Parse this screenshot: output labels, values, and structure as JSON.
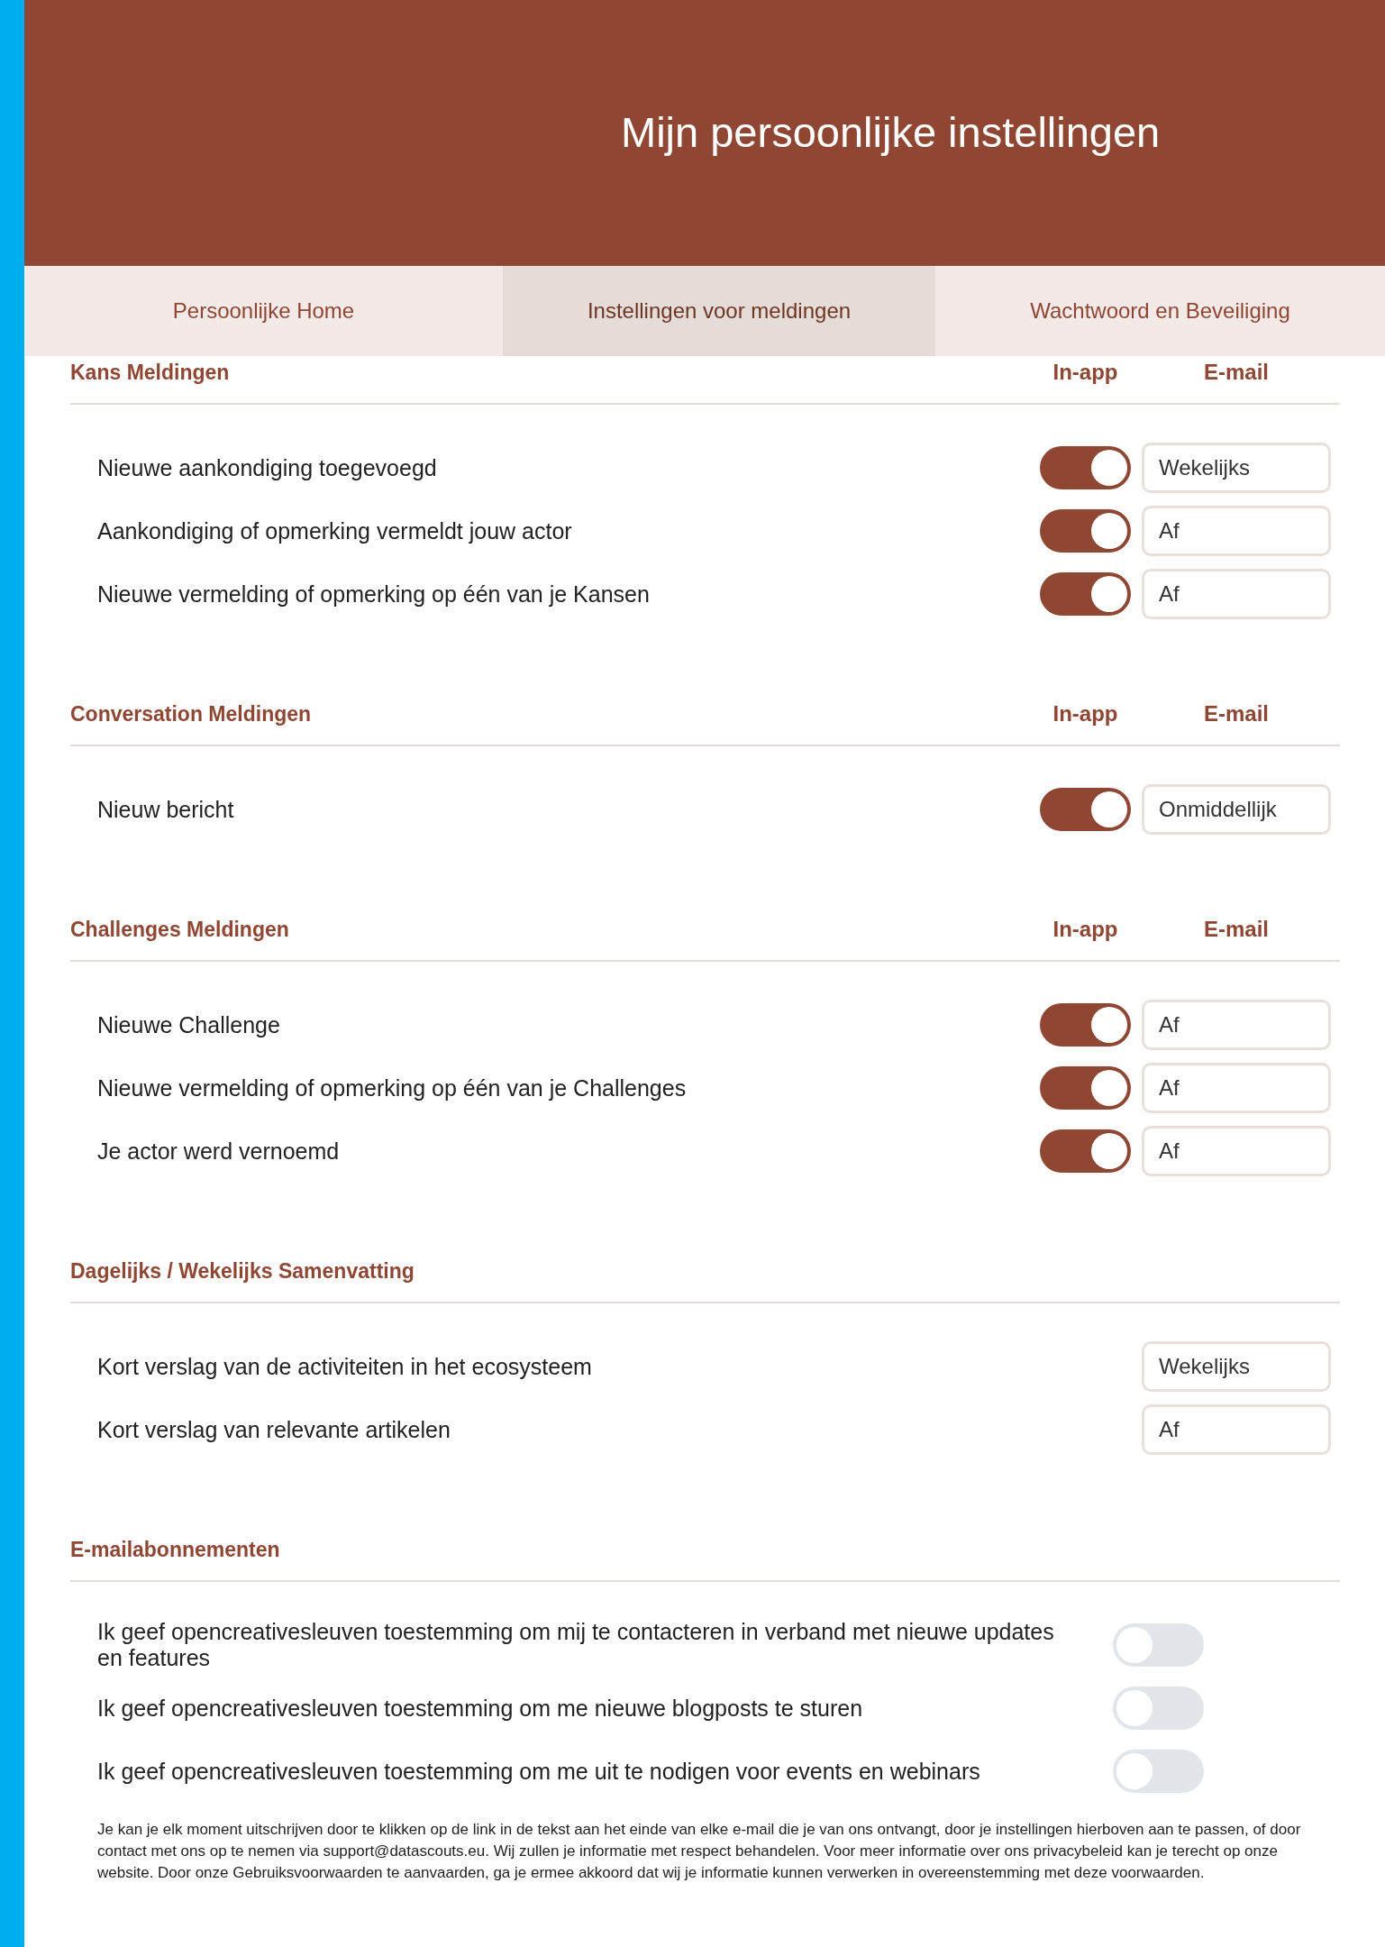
{
  "header": {
    "title": "Mijn persoonlijke instellingen"
  },
  "tabs": [
    {
      "label": "Persoonlijke Home",
      "selected": false
    },
    {
      "label": "Instellingen voor meldingen",
      "selected": true
    },
    {
      "label": "Wachtwoord en Beveiliging",
      "selected": false
    }
  ],
  "sections": [
    {
      "title": "Kans Meldingen",
      "columns": [
        "In-app",
        "E-mail"
      ],
      "rows": [
        {
          "kind": "channel",
          "label": "Nieuwe aankondiging toegevoegd",
          "in_app_on": true,
          "email": "Wekelijks"
        },
        {
          "kind": "channel",
          "label": "Aankondiging of opmerking vermeldt jouw actor",
          "in_app_on": true,
          "email": "Af"
        },
        {
          "kind": "channel",
          "label": "Nieuwe vermelding of opmerking op één van je Kansen",
          "in_app_on": true,
          "email": "Af"
        }
      ]
    },
    {
      "title": "Conversation Meldingen",
      "columns": [
        "In-app",
        "E-mail"
      ],
      "rows": [
        {
          "kind": "channel",
          "label": "Nieuw bericht",
          "in_app_on": true,
          "email": "Onmiddellijk"
        }
      ]
    },
    {
      "title": "Challenges Meldingen",
      "columns": [
        "In-app",
        "E-mail"
      ],
      "rows": [
        {
          "kind": "channel",
          "label": "Nieuwe Challenge",
          "in_app_on": true,
          "email": "Af"
        },
        {
          "kind": "channel",
          "label": "Nieuwe vermelding of opmerking op één van je Challenges",
          "in_app_on": true,
          "email": "Af"
        },
        {
          "kind": "channel",
          "label": "Je actor werd vernoemd",
          "in_app_on": true,
          "email": "Af"
        }
      ]
    },
    {
      "title": "Dagelijks / Wekelijks Samenvatting",
      "rows": [
        {
          "kind": "digest",
          "label": "Kort verslag van de activiteiten in het ecosysteem",
          "email": "Wekelijks"
        },
        {
          "kind": "digest",
          "label": "Kort verslag van relevante artikelen",
          "email": "Af"
        }
      ]
    },
    {
      "title": "E-mailabonnementen",
      "rows": [
        {
          "kind": "consent",
          "label": "Ik geef opencreativesleuven toestemming om mij te contacteren in verband met nieuwe updates en features",
          "on": false
        },
        {
          "kind": "consent",
          "label": "Ik geef opencreativesleuven toestemming om me nieuwe blogposts te sturen",
          "on": false
        },
        {
          "kind": "consent",
          "label": "Ik geef opencreativesleuven toestemming om me uit te nodigen voor events en webinars",
          "on": false
        }
      ]
    }
  ],
  "notice": "Je kan je elk moment uitschrijven door te klikken op de link in de tekst aan het einde van elke e-mail die je van ons ontvangt, door je instellingen hierboven aan te passen, of door contact met ons op te nemen via support@datascouts.eu. Wij zullen je informatie met respect behandelen. Voor meer informatie over ons privacybeleid kan je terecht op onze website. Door onze Gebruiksvoorwaarden te aanvaarden, ga je ermee akkoord dat wij je informatie kunnen verwerken in overeenstemming met deze voorwaarden."
}
